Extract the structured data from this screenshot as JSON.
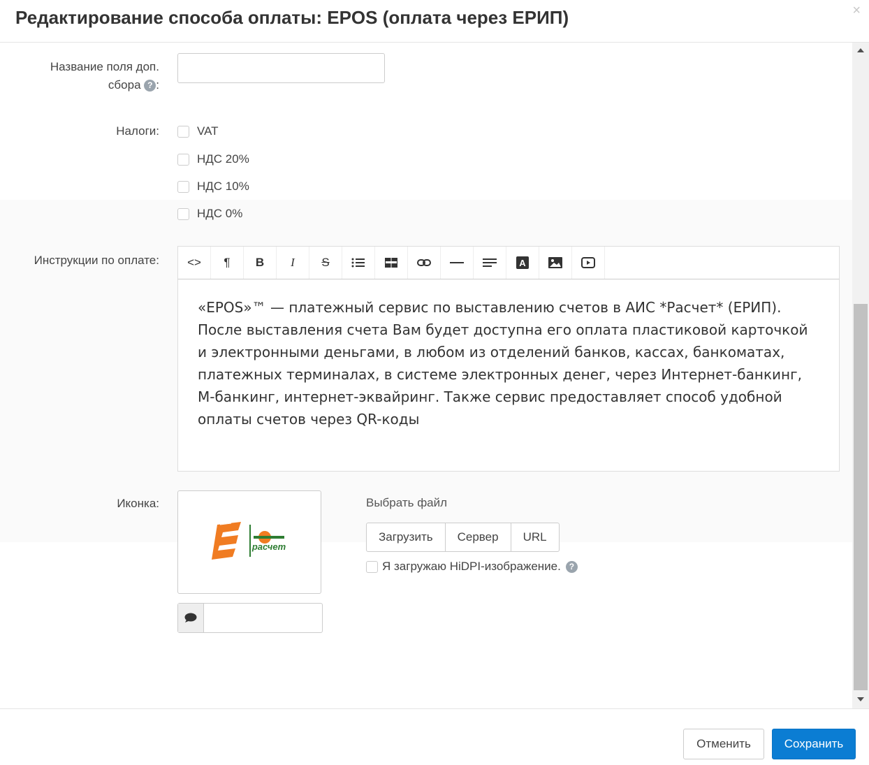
{
  "dialog": {
    "title": "Редактирование способа оплаты: EPOS (оплата через ЕРИП)",
    "close_glyph": "×"
  },
  "fields": {
    "fee_name": {
      "label_line1": "Название поля доп.",
      "label_line2": "сбора",
      "label_suffix": ":",
      "value": ""
    },
    "taxes": {
      "label": "Налоги:",
      "options": [
        {
          "label": "VAT",
          "checked": false
        },
        {
          "label": "НДС 20%",
          "checked": false
        },
        {
          "label": "НДС 10%",
          "checked": false
        },
        {
          "label": "НДС 0%",
          "checked": false
        }
      ]
    },
    "instructions": {
      "label": "Инструкции по оплате:",
      "toolbar": [
        {
          "name": "code-view-icon",
          "glyph": "<>"
        },
        {
          "name": "paragraph-icon",
          "glyph": "¶"
        },
        {
          "name": "bold-icon",
          "glyph": "B"
        },
        {
          "name": "italic-icon",
          "glyph": "I"
        },
        {
          "name": "strikethrough-icon",
          "glyph": "S"
        },
        {
          "name": "list-icon",
          "glyph": "☰"
        },
        {
          "name": "table-icon",
          "glyph": "▦"
        },
        {
          "name": "link-icon",
          "glyph": "⊂⊃"
        },
        {
          "name": "horizontal-rule-icon",
          "glyph": "—"
        },
        {
          "name": "align-icon",
          "glyph": "≡"
        },
        {
          "name": "font-color-icon",
          "glyph": "A"
        },
        {
          "name": "image-icon",
          "glyph": "▣"
        },
        {
          "name": "video-icon",
          "glyph": "▷"
        }
      ],
      "content": "«EPOS»™ — платежный сервис по выставлению счетов в АИС *Расчет* (ЕРИП). После выставления счета Вам будет доступна его оплата пластиковой карточкой и электронными деньгами, в любом из отделений банков, кассах, банкоматах, платежных терминалах, в системе электронных денег, через Интернет-банкинг, М-банкинг, интернет-эквайринг. Также сервис предоставляет способ удобной оплаты счетов через QR-коды"
    },
    "icon": {
      "label": "Иконка:",
      "logo_text": "расчет",
      "alt_value": "",
      "choose_file": "Выбрать файл",
      "buttons": [
        "Загрузить",
        "Сервер",
        "URL"
      ],
      "hidpi_label": "Я загружаю HiDPI-изображение."
    }
  },
  "footer": {
    "cancel_label": "Отменить",
    "save_label": "Сохранить"
  },
  "colors": {
    "primary": "#0b7dd3",
    "logo_orange": "#f07c22",
    "logo_green": "#2e7d32"
  }
}
